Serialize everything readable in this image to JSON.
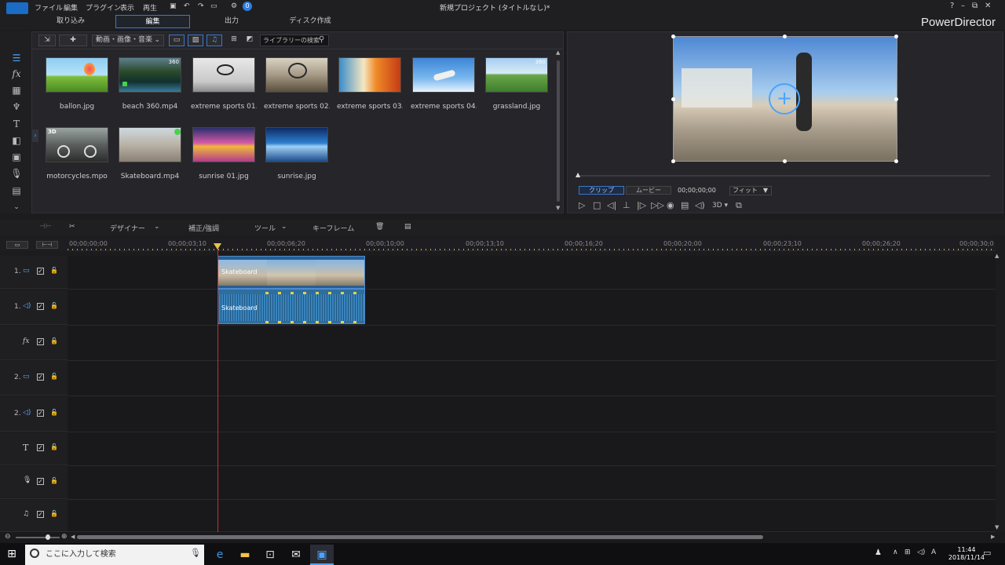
{
  "menu": {
    "items": [
      "ファイル",
      "編集",
      "プラグイン",
      "表示",
      "再生"
    ],
    "window_title": "新規プロジェクト (タイトルなし)*",
    "notification_badge": "0"
  },
  "mode_tabs": [
    "取り込み",
    "編集",
    "出力",
    "ディスク作成"
  ],
  "brand": "PowerDirector",
  "library": {
    "filter_label": "動画・画像・音楽",
    "search_placeholder": "ライブラリーの検索",
    "items": [
      {
        "label": "ballon.jpg",
        "tag": ""
      },
      {
        "label": "beach 360.mp4",
        "tag": "360"
      },
      {
        "label": "extreme sports 01...",
        "tag": ""
      },
      {
        "label": "extreme sports 02...",
        "tag": ""
      },
      {
        "label": "extreme sports 03...",
        "tag": ""
      },
      {
        "label": "extreme sports 04...",
        "tag": ""
      },
      {
        "label": "grassland.jpg",
        "tag": "360"
      },
      {
        "label": "motorcycles.mpo",
        "tag": "3D"
      },
      {
        "label": "Skateboard.mp4",
        "tag": ""
      },
      {
        "label": "sunrise 01.jpg",
        "tag": ""
      },
      {
        "label": "sunrise.jpg",
        "tag": ""
      }
    ]
  },
  "preview": {
    "clip_tab": "クリップ",
    "movie_tab": "ムービー",
    "timecode": "00;00;00;00",
    "fit_label": "フィット",
    "threed_label": "3D"
  },
  "timeline_toolbar": {
    "designer": "デザイナー",
    "correction": "補正/強調",
    "tools": "ツール",
    "keyframe": "キーフレーム"
  },
  "ruler": {
    "ticks": [
      "00;00;00;00",
      "00;00;03;10",
      "00;00;06;20",
      "00;00;10;00",
      "00;00;13;10",
      "00;00;16;20",
      "00;00;20;00",
      "00;00;23;10",
      "00;00;26;20",
      "00;00;30;0"
    ]
  },
  "tracks": [
    {
      "num": "1.",
      "icon": "video-track-icon",
      "type": "video"
    },
    {
      "num": "1.",
      "icon": "audio-track-icon",
      "type": "audio"
    },
    {
      "num": "",
      "icon": "fx-track-icon",
      "type": "fx"
    },
    {
      "num": "2.",
      "icon": "video-track-icon",
      "type": "video"
    },
    {
      "num": "2.",
      "icon": "audio-track-icon",
      "type": "audio"
    },
    {
      "num": "",
      "icon": "title-track-icon",
      "type": "title"
    },
    {
      "num": "",
      "icon": "voice-track-icon",
      "type": "voice"
    },
    {
      "num": "",
      "icon": "music-track-icon",
      "type": "music"
    }
  ],
  "clips": {
    "video_label": "Skateboard",
    "audio_label": "Skateboard"
  },
  "taskbar": {
    "search_placeholder": "ここに入力して検索",
    "time": "11:44",
    "date": "2018/11/14"
  }
}
